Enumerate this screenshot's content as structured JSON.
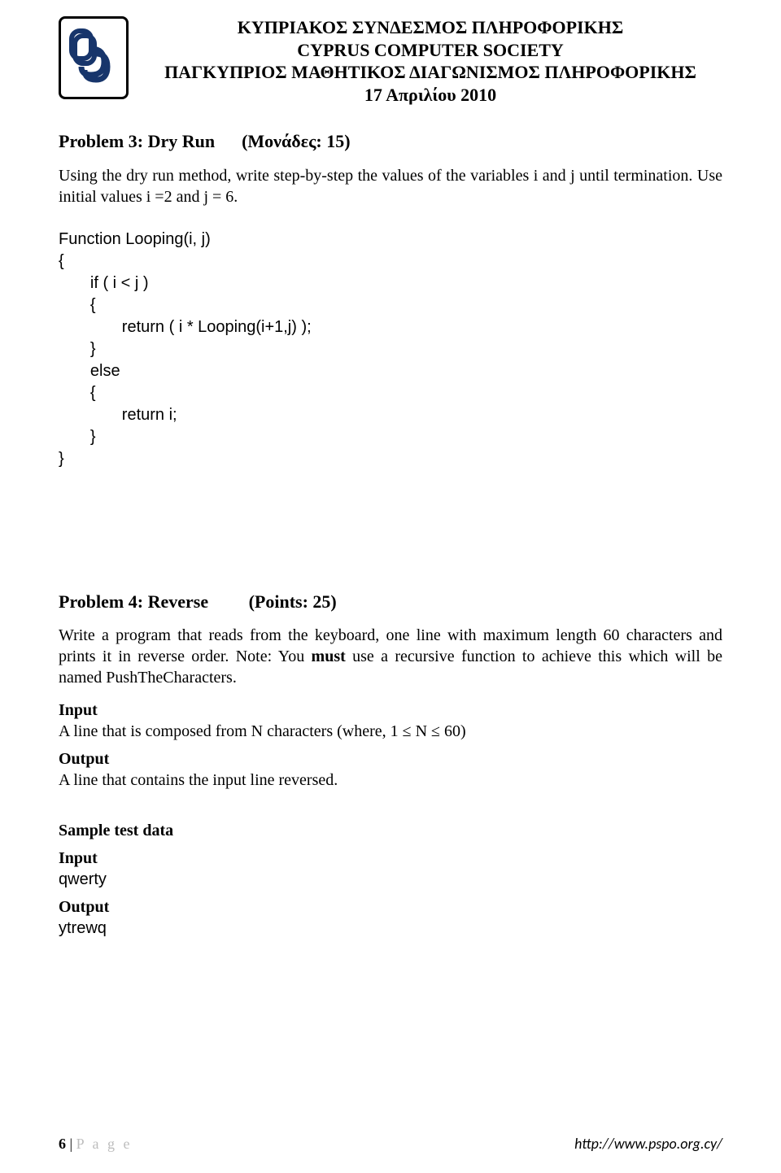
{
  "header": {
    "line1": "ΚΥΠΡΙΑΚΟΣ ΣΥΝΔΕΣΜΟΣ ΠΛΗΡΟΦΟΡΙΚΗΣ",
    "line2": "CYPRUS COMPUTER SOCIETY",
    "line3": "ΠΑΓΚΥΠΡΙΟΣ ΜΑΘΗΤΙΚΟΣ ΔΙΑΓΩΝΙΣΜΟΣ ΠΛΗΡΟΦΟΡΙΚΗΣ",
    "line4": "17 Απριλίου 2010"
  },
  "p3": {
    "title": "Problem 3: Dry Run",
    "points": "(Μονάδες: 15)",
    "desc": "Using the dry run method, write step-by-step the values of the variables i and j until termination. Use initial values i =2 and j = 6."
  },
  "code": {
    "l1": "Function Looping(i, j)",
    "l2": "{",
    "l3": "       if ( i < j )",
    "l4": "       {",
    "l5": "              return ( i * Looping(i+1,j) );",
    "l6": "       }",
    "l7": "       else",
    "l8": "       {",
    "l9": "              return i;",
    "l10": "       }",
    "l11": "}"
  },
  "p4": {
    "title": "Problem 4: Reverse",
    "points": "(Points: 25)",
    "desc_pre": "Write a program that reads from the keyboard, one line with maximum length 60 characters and prints it in reverse order. Note: You ",
    "desc_bold": "must",
    "desc_post": " use a recursive function to achieve this which will be named PushTheCharacters.",
    "input_label": "Input",
    "input_text": "A line that is composed from N characters (where, 1 ≤ N ≤ 60)",
    "output_label": "Output",
    "output_text": "A line that contains the input line reversed.",
    "sample_label": "Sample test data",
    "sample_input_label": "Input",
    "sample_input": "qwerty",
    "sample_output_label": "Output",
    "sample_output": "ytrewq"
  },
  "footer": {
    "pagenum": "6",
    "pagesep": " | ",
    "pagelabel": "P a g e",
    "url": "http://www.pspo.org.cy/"
  }
}
